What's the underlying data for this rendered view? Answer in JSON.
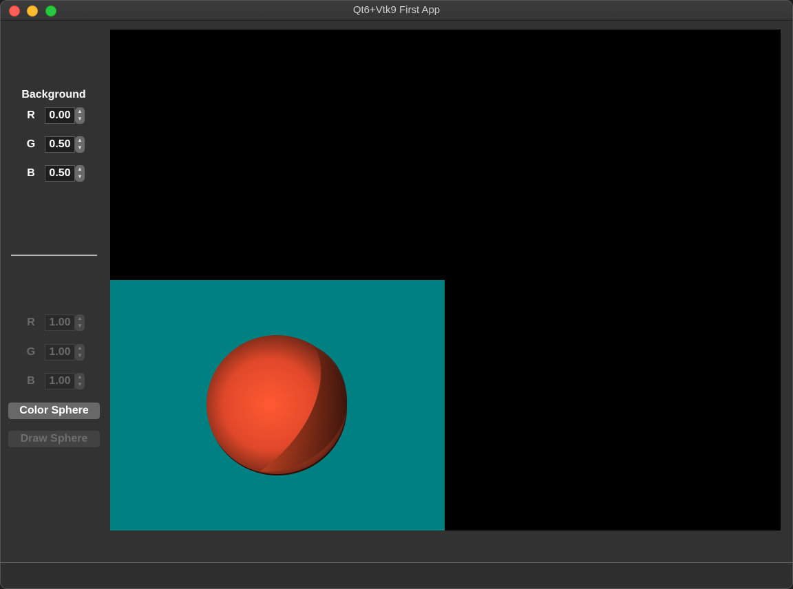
{
  "window": {
    "title": "Qt6+Vtk9 First App"
  },
  "background_panel": {
    "title": "Background",
    "r": {
      "label": "R",
      "value": "0.00"
    },
    "g": {
      "label": "G",
      "value": "0.50"
    },
    "b": {
      "label": "B",
      "value": "0.50"
    }
  },
  "sphere_panel": {
    "r": {
      "label": "R",
      "value": "1.00"
    },
    "g": {
      "label": "G",
      "value": "1.00"
    },
    "b": {
      "label": "B",
      "value": "1.00"
    },
    "color_button": "Color Sphere",
    "draw_button": "Draw Sphere"
  },
  "colors": {
    "viewport_background": "#008080",
    "sphere": "#ff5a32",
    "render_background": "#000000"
  },
  "icons": {
    "close": "close-icon",
    "minimize": "minimize-icon",
    "maximize": "maximize-icon",
    "stepper": "stepper-icon"
  }
}
